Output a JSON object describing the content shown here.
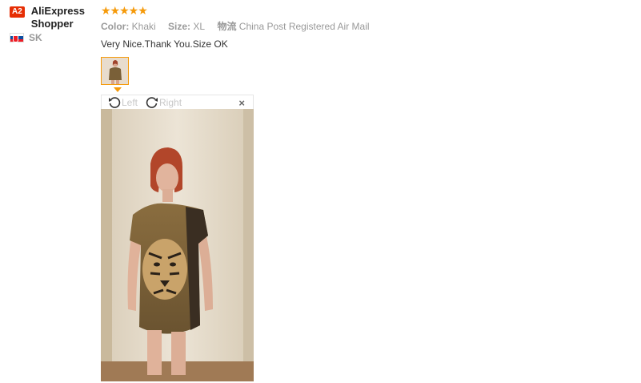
{
  "reviewer": {
    "level_badge": "A2",
    "name": "AliExpress Shopper",
    "country": "SK"
  },
  "review": {
    "rating_stars": "★★★★★",
    "color_key": "Color:",
    "color_value": "Khaki",
    "size_key": "Size:",
    "size_value": "XL",
    "shipping_key": "物流",
    "shipping_value": "China Post Registered Air Mail",
    "text": "Very Nice.Thank You.Size OK"
  },
  "viewer": {
    "rotate_left_label": "Left",
    "rotate_right_label": "Right",
    "close_symbol": "×"
  },
  "colors": {
    "accent": "#f59a0a",
    "badge": "#e62e04"
  }
}
